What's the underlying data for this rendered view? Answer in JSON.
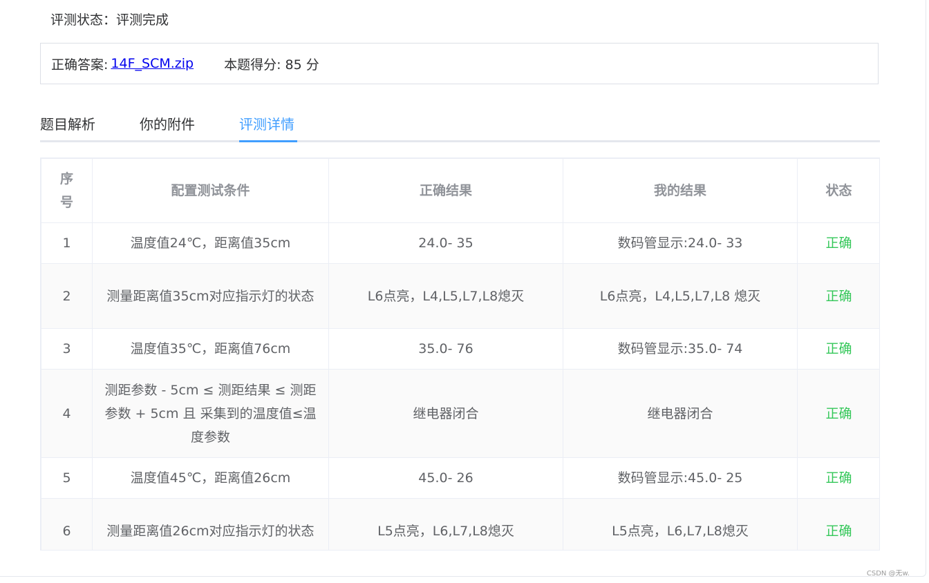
{
  "evaluation_status": {
    "label": "评测状态：",
    "value": "评测完成"
  },
  "answer": {
    "label": "正确答案:",
    "file_link": "14F_SCM.zip",
    "score_label": "本题得分: 85 分"
  },
  "tabs": [
    {
      "label": "题目解析",
      "active": false
    },
    {
      "label": "你的附件",
      "active": false
    },
    {
      "label": "评测详情",
      "active": true
    }
  ],
  "table": {
    "headers": [
      "序号",
      "配置测试条件",
      "正确结果",
      "我的结果",
      "状态"
    ],
    "rows": [
      [
        "1",
        "温度值24℃，距离值35cm",
        "24.0- 35",
        "数码管显示:24.0- 33",
        "正确"
      ],
      [
        "2",
        "测量距离值35cm对应指示灯的状态",
        "L6点亮，L4,L5,L7,L8熄灭",
        "L6点亮，L4,L5,L7,L8 熄灭",
        "正确"
      ],
      [
        "3",
        "温度值35℃，距离值76cm",
        "35.0- 76",
        "数码管显示:35.0- 74",
        "正确"
      ],
      [
        "4",
        "测距参数 - 5cm ≤ 测距结果 ≤ 测距参数 + 5cm 且 采集到的温度值≤温度参数",
        "继电器闭合",
        "继电器闭合",
        "正确"
      ],
      [
        "5",
        "温度值45℃，距离值26cm",
        "45.0- 26",
        "数码管显示:45.0- 25",
        "正确"
      ],
      [
        "6",
        "测量距离值26cm对应指示灯的状态",
        "L5点亮，L6,L7,L8熄灭",
        "L5点亮，L6,L7,L8熄灭",
        "正确"
      ]
    ]
  },
  "watermark": "CSDN @无w.",
  "colors": {
    "accent": "#409eff",
    "success": "#34c759",
    "link": "#0000ee"
  }
}
